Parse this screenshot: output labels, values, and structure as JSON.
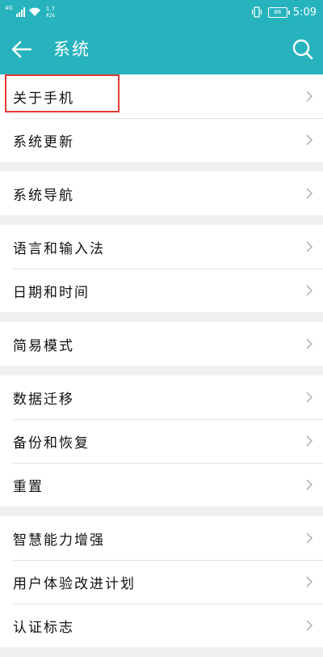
{
  "status_bar": {
    "network_type": "4G",
    "speed_value": "1.7",
    "speed_unit": "K/s",
    "battery": "88",
    "time": "5:09"
  },
  "header": {
    "title": "系统",
    "back_icon": "arrow-left-icon",
    "search_icon": "search-icon"
  },
  "colors": {
    "accent": "#26b3be",
    "highlight": "#e53935"
  },
  "groups": [
    {
      "items": [
        {
          "label": "关于手机",
          "highlighted": true
        },
        {
          "label": "系统更新"
        }
      ]
    },
    {
      "items": [
        {
          "label": "系统导航"
        }
      ]
    },
    {
      "items": [
        {
          "label": "语言和输入法"
        },
        {
          "label": "日期和时间"
        }
      ]
    },
    {
      "items": [
        {
          "label": "简易模式"
        }
      ]
    },
    {
      "items": [
        {
          "label": "数据迁移"
        },
        {
          "label": "备份和恢复"
        },
        {
          "label": "重置"
        }
      ]
    },
    {
      "items": [
        {
          "label": "智慧能力增强"
        },
        {
          "label": "用户体验改进计划"
        },
        {
          "label": "认证标志"
        }
      ]
    }
  ]
}
